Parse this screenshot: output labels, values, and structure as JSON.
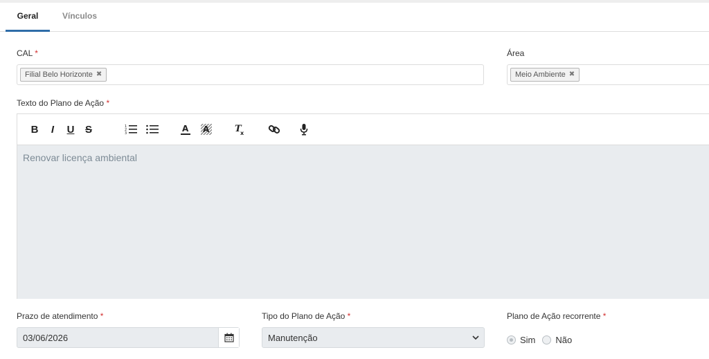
{
  "tabs": [
    {
      "label": "Geral",
      "active": true
    },
    {
      "label": "Vínculos",
      "active": false
    }
  ],
  "cal": {
    "label": "CAL",
    "required_mark": "*",
    "tags": [
      "Filial Belo Horizonte"
    ]
  },
  "area": {
    "label": "Área",
    "tags": [
      "Meio Ambiente"
    ]
  },
  "texto": {
    "label": "Texto do Plano de Ação",
    "required_mark": "*",
    "toolbar": [
      "bold-icon",
      "italic-icon",
      "underline-icon",
      "strikethrough-icon",
      "ordered-list-icon",
      "bullet-list-icon",
      "font-color-icon",
      "background-color-icon",
      "clear-format-icon",
      "link-icon",
      "microphone-icon"
    ],
    "content": "Renovar licença ambiental"
  },
  "prazo": {
    "label": "Prazo de atendimento",
    "required_mark": "*",
    "value": "03/06/2026",
    "icon": "calendar-icon"
  },
  "tipo": {
    "label": "Tipo do Plano de Ação",
    "required_mark": "*",
    "selected": "Manutenção",
    "icon": "chevron-down-icon"
  },
  "recorrente": {
    "label": "Plano de Ação recorrente",
    "required_mark": "*",
    "options": [
      {
        "label": "Sim",
        "checked": true
      },
      {
        "label": "Não",
        "checked": false
      }
    ]
  },
  "colors": {
    "accent": "#2f6da8",
    "required": "#d32f2f",
    "disabled_bg": "#e9ecef",
    "placeholder_text": "#7d8b96"
  }
}
